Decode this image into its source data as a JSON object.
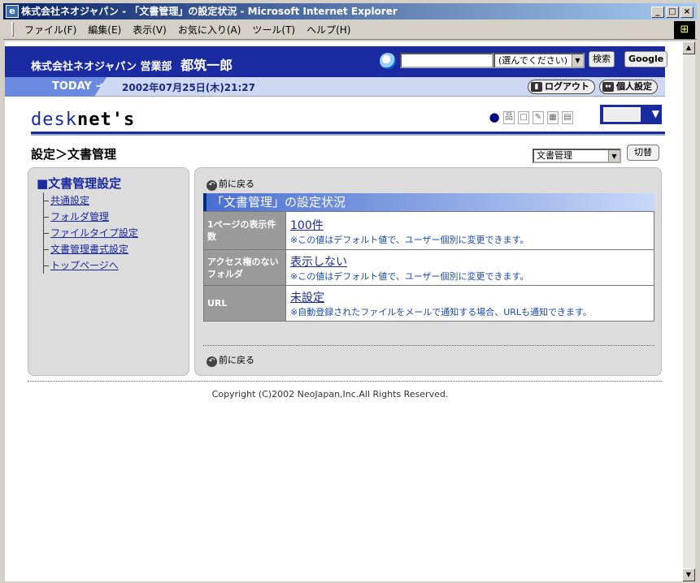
{
  "window": {
    "title": "株式会社ネオジャパン - 「文書管理」の設定状況 - Microsoft Internet Explorer",
    "buttons": [
      "_",
      "□",
      "×"
    ]
  },
  "menubar": [
    "ファイル(F)",
    "編集(E)",
    "表示(V)",
    "お気に入り(A)",
    "ツール(T)",
    "ヘルプ(H)"
  ],
  "header": {
    "company": "株式会社ネオジャパン",
    "dept": "営業部",
    "user": "都筑一郎",
    "search_select": "(選んでください)",
    "search_button": "検索",
    "google_button": "Google"
  },
  "strip": {
    "today_label": "TODAY",
    "date": "2002年07月25日(木)21:27",
    "logout": "ログアウト",
    "personal": "個人設定"
  },
  "logo": {
    "light": "desk",
    "bold": "net's"
  },
  "crumb": "設定＞文書管理",
  "module_select": "文書管理",
  "switch_button": "切替",
  "sidebar": {
    "title": "■文書管理設定",
    "items": [
      "共通設定",
      "フォルダ管理",
      "ファイルタイプ設定",
      "文書管理書式設定",
      "トップページへ"
    ]
  },
  "main": {
    "back_top": "前に戻る",
    "caption": "「文書管理」の設定状況",
    "rows": [
      {
        "label": "1ページの表示件数",
        "value": "100件",
        "note": "※この値はデフォルト値で、ユーザー個別に変更できます。"
      },
      {
        "label": "アクセス権のないフォルダ",
        "value": "表示しない",
        "note": "※この値はデフォルト値で、ユーザー個別に変更できます。"
      },
      {
        "label": "URL",
        "value": "未設定",
        "note": "※自動登録されたファイルをメールで通知する場合、URLも通知できます。"
      }
    ],
    "back_bottom": "前に戻る"
  },
  "footer": "Copyright (C)2002 NeoJapan,Inc.All Rights Reserved."
}
